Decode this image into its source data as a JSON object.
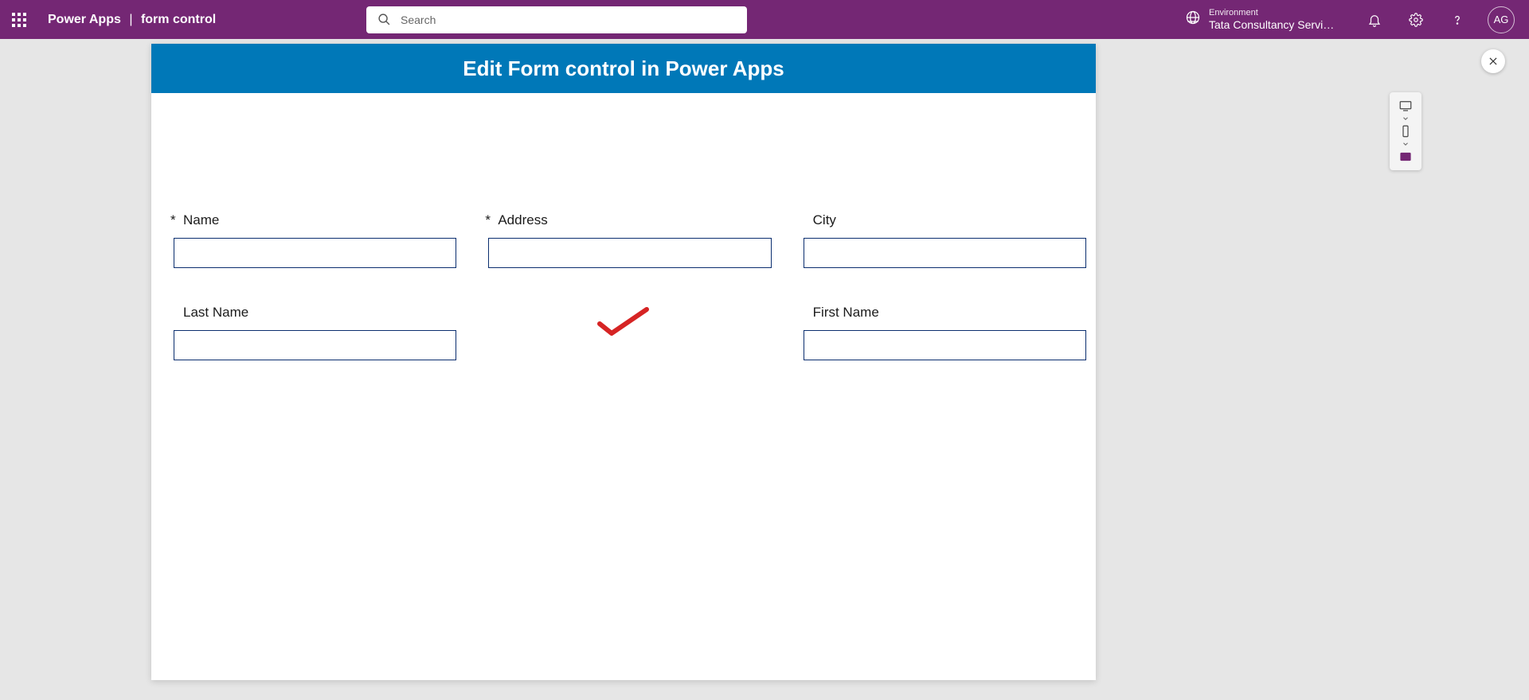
{
  "header": {
    "app_name": "Power Apps",
    "page_name": "form control",
    "search_placeholder": "Search",
    "environment_label": "Environment",
    "environment_name": "Tata Consultancy Servic...",
    "avatar_initials": "AG"
  },
  "preview": {
    "title": "Edit Form control in Power Apps"
  },
  "form": {
    "fields": [
      {
        "label": "Name",
        "required": true,
        "value": ""
      },
      {
        "label": "Address",
        "required": true,
        "value": ""
      },
      {
        "label": "City",
        "required": false,
        "value": ""
      },
      {
        "label": "Last Name",
        "required": false,
        "value": ""
      },
      {
        "label": "First Name",
        "required": false,
        "value": ""
      }
    ]
  },
  "device_panel": {
    "desktop": "desktop",
    "phone": "phone",
    "fit": "fit-to-window"
  }
}
